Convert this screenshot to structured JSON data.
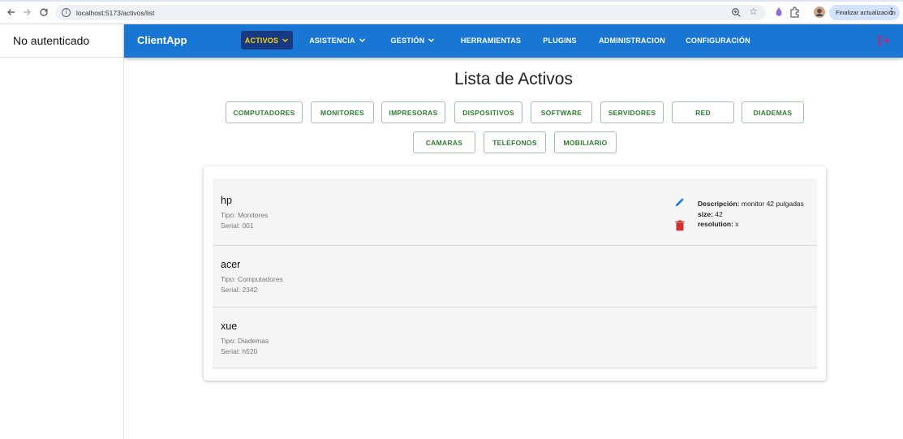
{
  "browser": {
    "url": "localhost:5173/activos/list",
    "update_label": "Finalizar actualización"
  },
  "left_panel": {
    "title": "No autenticado"
  },
  "appbar": {
    "brand": "ClientApp",
    "menu": [
      {
        "label": "ACTIVOS",
        "dropdown": true,
        "active": true
      },
      {
        "label": "ASISTENCIA",
        "dropdown": true
      },
      {
        "label": "GESTIÓN",
        "dropdown": true
      },
      {
        "label": "HERRAMIENTAS"
      },
      {
        "label": "PLUGINS"
      },
      {
        "label": "ADMINISTRACION"
      },
      {
        "label": "CONFIGURACIÓN"
      }
    ],
    "colors": {
      "bar": "#1976d2",
      "active_bg": "#173a82",
      "active_text": "#ffd400",
      "logout": "#d81b60"
    }
  },
  "main": {
    "title": "Lista de Activos",
    "categories_row1": [
      "COMPUTADORES",
      "MONITORES",
      "IMPRESORAS",
      "DISPOSITIVOS",
      "SOFTWARE",
      "SERVIDORES",
      "RED",
      "DIADEMAS"
    ],
    "categories_row2": [
      "CAMARAS",
      "TELEFONOS",
      "MOBILIARIO"
    ],
    "assets": [
      {
        "name": "hp",
        "tipo": "Tipo: Monitores",
        "serial": "Serial: 001",
        "details": [
          {
            "key": "Descripción:",
            "value": "monitor 42 pulgadas"
          },
          {
            "key": "size:",
            "value": "42"
          },
          {
            "key": "resolution:",
            "value": "x"
          }
        ]
      },
      {
        "name": "acer",
        "tipo": "Tipo: Computadores",
        "serial": "Serial: 2342"
      },
      {
        "name": "xue",
        "tipo": "Tipo: Diademas",
        "serial": "Serial: h520"
      }
    ],
    "colors": {
      "category_text": "#2e7d32",
      "edit_icon": "#1976d2",
      "delete_icon": "#d32f2f"
    }
  }
}
